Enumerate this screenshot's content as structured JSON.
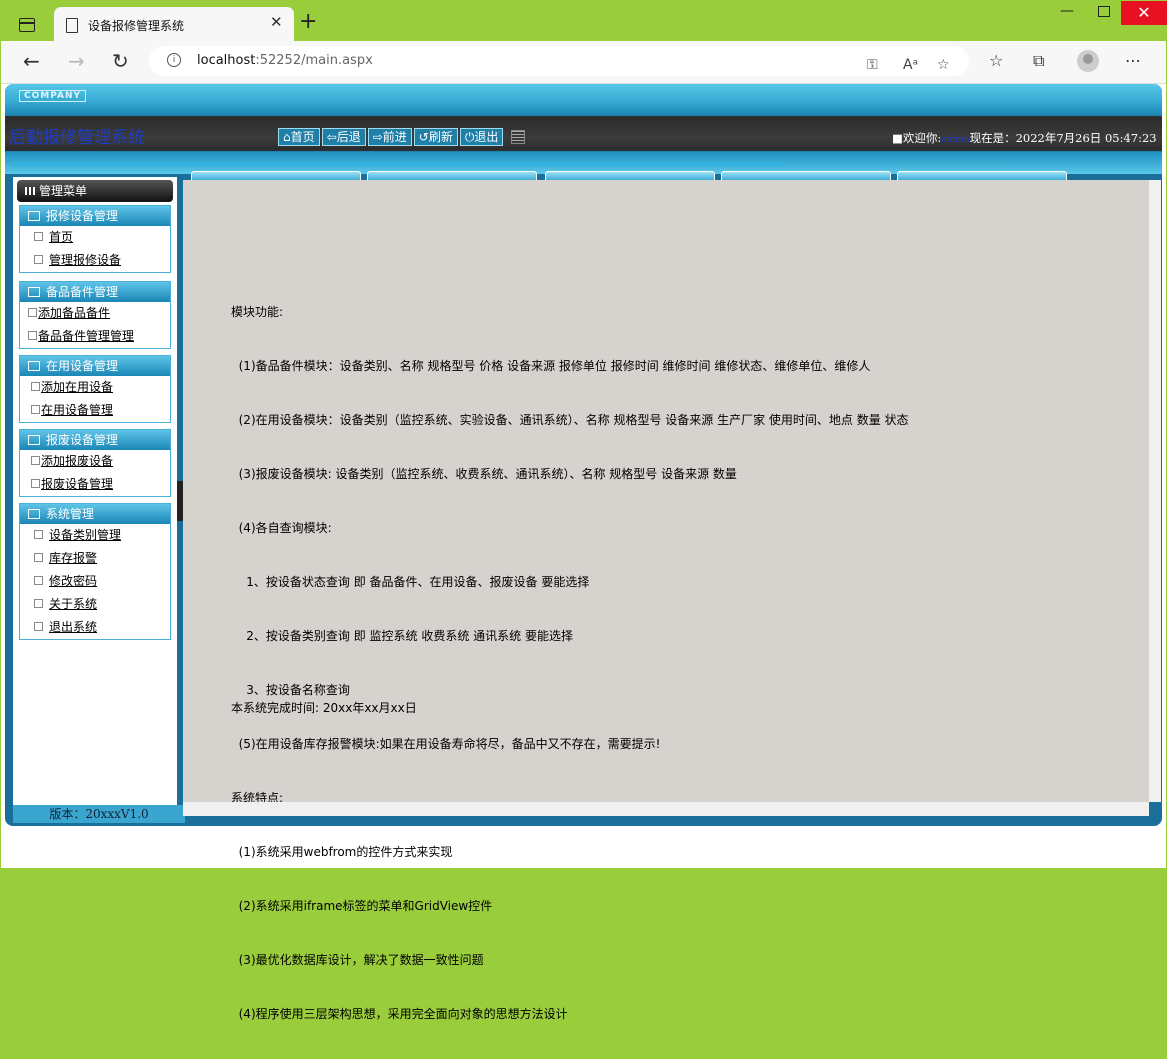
{
  "browser": {
    "tab_title": "设备报修管理系统",
    "url_host": "localhost",
    "url_rest": ":52252/main.aspx"
  },
  "header": {
    "company": "COMPANY",
    "title": "后勤报修管理系统",
    "nav": [
      "首页",
      "后退",
      "前进",
      "刷新",
      "退出"
    ],
    "nav_icons": [
      "home-icon",
      "back-icon",
      "forward-icon",
      "refresh-icon",
      "power-icon"
    ],
    "welcome_prefix": "欢迎你:",
    "user": "admin",
    "time_prefix": "现在是：",
    "time": "2022年7月26日 05:47:23"
  },
  "menu": {
    "title": "管理菜单",
    "groups": [
      {
        "title": "报修设备管理",
        "items": [
          "首页",
          "管理报修设备"
        ]
      },
      {
        "title": "备品备件管理",
        "items": [
          "添加备品备件",
          "备品备件管理管理"
        ]
      },
      {
        "title": "在用设备管理",
        "items": [
          "添加在用设备",
          "在用设备管理"
        ]
      },
      {
        "title": "报废设备管理",
        "items": [
          "添加报废设备",
          "报废设备管理"
        ]
      },
      {
        "title": "系统管理",
        "items": [
          "设备类别管理",
          "库存报警",
          "修改密码",
          "关于系统",
          "退出系统"
        ]
      }
    ],
    "version": "版本：20xxxV1.0"
  },
  "content": {
    "lines": [
      "模块功能:",
      "  (1)备品备件模块：设备类别、名称 规格型号 价格 设备来源 报修单位 报修时间 维修时间 维修状态、维修单位、维修人",
      "  (2)在用设备模块：设备类别（监控系统、实验设备、通讯系统）、名称 规格型号 设备来源 生产厂家 使用时间、地点 数量 状态",
      "  (3)报废设备模块: 设备类别（监控系统、收费系统、通讯系统）、名称 规格型号 设备来源 数量",
      "  (4)各自查询模块:",
      "    1、按设备状态查询 即 备品备件、在用设备、报废设备 要能选择",
      "    2、按设备类别查询 即 监控系统 收费系统 通讯系统 要能选择",
      "    3、按设备名称查询",
      "  (5)在用设备库存报警模块:如果在用设备寿命将尽，备品中又不存在，需要提示!",
      "系统特点:",
      "  (1)系统采用webfrom的控件方式来实现",
      "  (2)系统采用iframe标签的菜单和GridView控件",
      "  (3)最优化数据库设计，解决了数据一致性问题",
      "  (4)程序使用三层架构思想，采用完全面向对象的思想方法设计"
    ],
    "finish": "本系统完成时间: 20xx年xx月xx日"
  }
}
